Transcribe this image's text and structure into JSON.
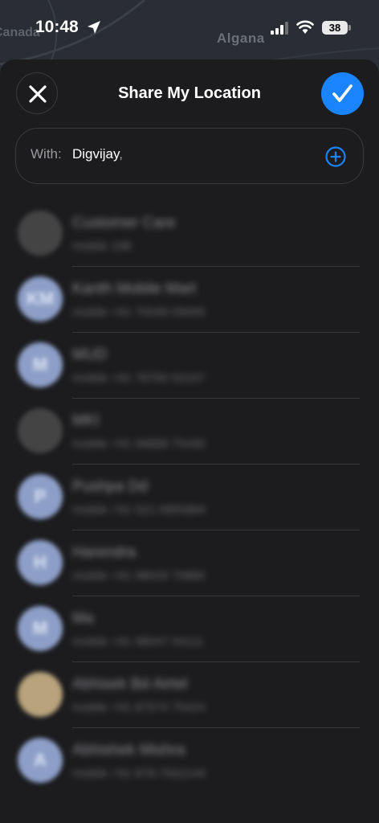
{
  "status_bar": {
    "time": "10:48",
    "battery": "38"
  },
  "map": {
    "label_right": "Algana",
    "label_left": "Canada"
  },
  "header": {
    "title": "Share My Location"
  },
  "to_field": {
    "label": "With:",
    "value": "Digvijay",
    "separator": ","
  },
  "contacts": [
    {
      "name": "Customer Care",
      "detail": "mobile 198",
      "initials": "",
      "avatar": "photo"
    },
    {
      "name": "Kanth Mobile Mart",
      "detail": "mobile +91 70046 05005",
      "initials": "KM",
      "avatar": "initials"
    },
    {
      "name": "MUD",
      "detail": "mobile +91 78760 52107",
      "initials": "M",
      "avatar": "initials"
    },
    {
      "name": "MKI",
      "detail": "mobile +91 99888 75430",
      "initials": "",
      "avatar": "photo"
    },
    {
      "name": "Pushpa Dd",
      "detail": "mobile +91 021-0895884",
      "initials": "P",
      "avatar": "initials"
    },
    {
      "name": "Harendra",
      "detail": "mobile +91 98029 70880",
      "initials": "H",
      "avatar": "initials"
    },
    {
      "name": "Ma",
      "detail": "mobile +91 98047 04111",
      "initials": "M",
      "avatar": "initials"
    },
    {
      "name": "Abhisek Bd Airtel",
      "detail": "mobile +91 87574 75424",
      "initials": "",
      "avatar": "emoji"
    },
    {
      "name": "Abhishek Mishra",
      "detail": "mobile +91 878-7502144",
      "initials": "A",
      "avatar": "initials"
    }
  ],
  "colors": {
    "accent": "#1a84ff",
    "background": "#1c1c1e",
    "avatar": "#8d9fc8"
  },
  "icons": {
    "close": "close-icon",
    "done": "checkmark-icon",
    "add": "plus-circle-icon",
    "location": "location-arrow-icon"
  }
}
